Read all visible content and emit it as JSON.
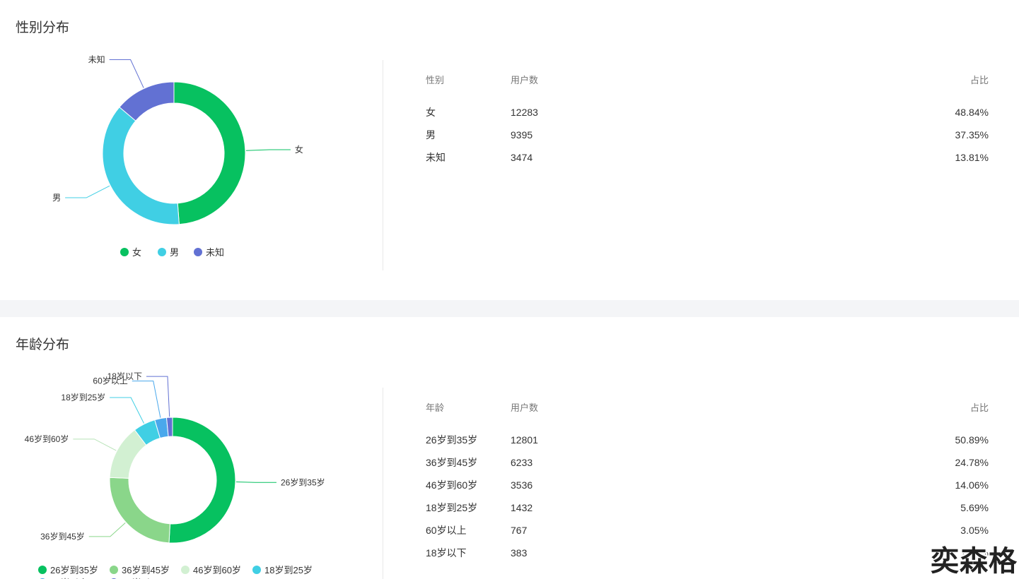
{
  "gender": {
    "title": "性别分布",
    "table": {
      "headers": [
        "性别",
        "用户数",
        "占比"
      ],
      "rows": [
        [
          "女",
          "12283",
          "48.84%"
        ],
        [
          "男",
          "9395",
          "37.35%"
        ],
        [
          "未知",
          "3474",
          "13.81%"
        ]
      ]
    }
  },
  "age": {
    "title": "年龄分布",
    "table": {
      "headers": [
        "年龄",
        "用户数",
        "占比"
      ],
      "rows": [
        [
          "26岁到35岁",
          "12801",
          "50.89%"
        ],
        [
          "36岁到45岁",
          "6233",
          "24.78%"
        ],
        [
          "46岁到60岁",
          "3536",
          "14.06%"
        ],
        [
          "18岁到25岁",
          "1432",
          "5.69%"
        ],
        [
          "60岁以上",
          "767",
          "3.05%"
        ],
        [
          "18岁以下",
          "383",
          "1.52%"
        ]
      ]
    }
  },
  "watermark": "奕森格",
  "chart_data": [
    {
      "type": "pie",
      "title": "性别分布",
      "categories": [
        "女",
        "男",
        "未知"
      ],
      "values": [
        12283,
        9395,
        3474
      ],
      "colors": [
        "#07c160",
        "#40cfe4",
        "#6271d3"
      ],
      "donut": true,
      "legend": "bottom"
    },
    {
      "type": "pie",
      "title": "年龄分布",
      "categories": [
        "26岁到35岁",
        "36岁到45岁",
        "46岁到60岁",
        "18岁到25岁",
        "60岁以上",
        "18岁以下"
      ],
      "values": [
        12801,
        6233,
        3536,
        1432,
        767,
        383
      ],
      "colors": [
        "#07c160",
        "#8ad68a",
        "#d2f0d2",
        "#40cfe4",
        "#4aa8ec",
        "#6271d3"
      ],
      "donut": true,
      "legend": "bottom"
    }
  ]
}
